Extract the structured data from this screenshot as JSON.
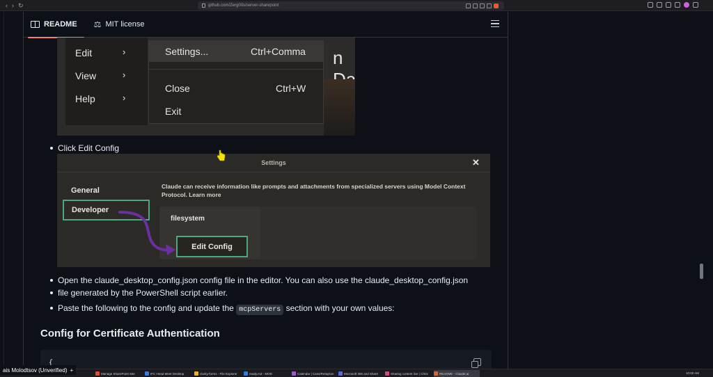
{
  "browser": {
    "nav": [
      "‹",
      "›",
      "↻"
    ],
    "url": "github.com/Zerg00s/server-sharepoint"
  },
  "tabs": {
    "readme": "README",
    "license": "MIT license"
  },
  "menu_screenshot": {
    "menu_items": [
      "Edit",
      "View",
      "Help"
    ],
    "submenu": [
      {
        "label": "Settings...",
        "shortcut": "Ctrl+Comma"
      },
      {
        "label": "Close",
        "shortcut": "Ctrl+W"
      },
      {
        "label": "Exit",
        "shortcut": ""
      }
    ],
    "background_title": "n Da"
  },
  "bullets": {
    "click_edit": "Click Edit Config",
    "open_config": "Open the claude_desktop_config.json config file in the editor. You can also use the claude_desktop_config.json",
    "open_config_2": "file generated by the PowerShell script earlier.",
    "paste_prefix": "Paste the following to the config and update the",
    "paste_code": "mcpServers",
    "paste_suffix": "section with your own values:"
  },
  "settings_screenshot": {
    "title": "Settings",
    "close": "✕",
    "general": "General",
    "developer": "Developer",
    "description": "Claude can receive information like prompts and attachments from specialized servers using Model Context Protocol. Learn more",
    "server": "filesystem",
    "edit_button": "Edit Config",
    "arrow_color": "#6a2fa0",
    "highlight_color": "#4fa884"
  },
  "section": {
    "heading": "Config for Certificate Authentication",
    "code_first_line": "{"
  },
  "taskbar": {
    "user": "ais Molodtsov (Unverified)",
    "items": [
      {
        "label": "Manage SharePoint Site",
        "color": "#e04a3a"
      },
      {
        "label": "IFC Head Meet Desktop",
        "color": "#3a7be0"
      },
      {
        "label": "clarity-forms - File Explorer",
        "color": "#e6b422"
      },
      {
        "label": "ready.md - MOD",
        "color": "#2f7de1"
      },
      {
        "label": "Calendar | Cans/Relaytion",
        "color": "#9b59d0"
      },
      {
        "label": "Microsoft 365 and Share",
        "color": "#5b6ad0"
      },
      {
        "label": "Sharing content live | Chris",
        "color": "#d04a7a"
      },
      {
        "label": "README - Claude.ai",
        "color": "#d0643a"
      }
    ],
    "clock": "10:00 AM"
  }
}
